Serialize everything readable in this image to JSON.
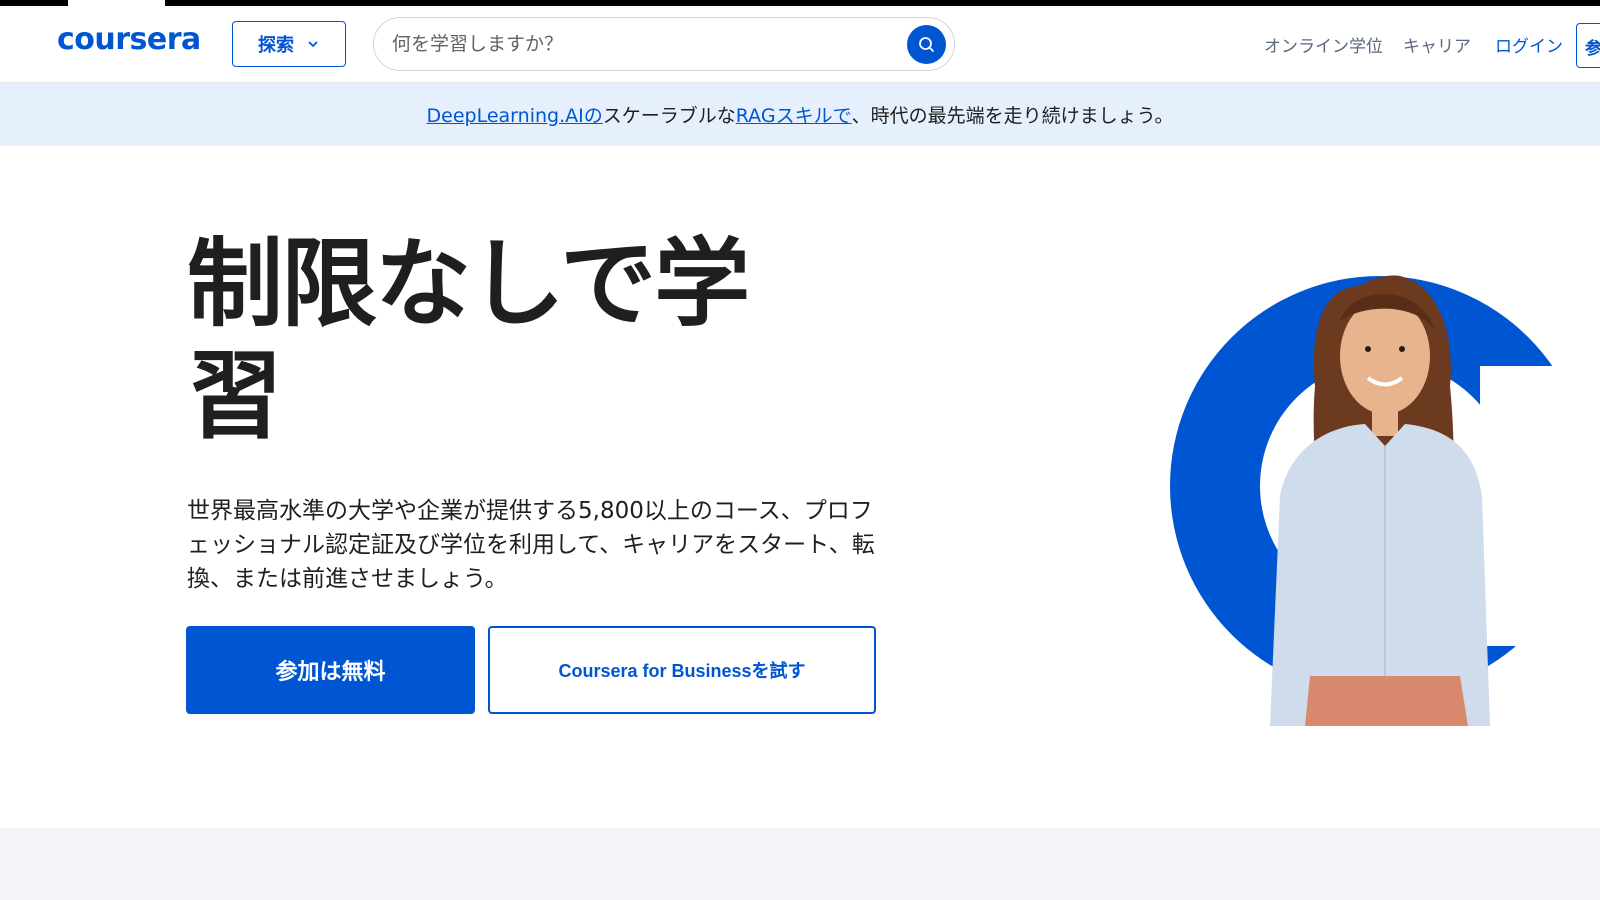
{
  "header": {
    "logo": "coursera",
    "explore_label": "探索",
    "search_placeholder": "何を学習しますか？",
    "nav": {
      "degrees": "オンライン学位",
      "careers": "キャリア",
      "login": "ログイン",
      "join": "参"
    }
  },
  "banner": {
    "link1": "DeepLearning.AIの",
    "text1": "スケーラブルな",
    "link2": "RAGスキルで",
    "text2": "、時代の最先端を走り続けましょう。"
  },
  "hero": {
    "title": "制限なしで学習",
    "description": "世界最高水準の大学や企業が提供する5,800以上のコース、プロフェッショナル認定証及び学位を利用して、キャリアをスタート、転換、または前進させましょう。",
    "primary_cta": "参加は無料",
    "secondary_cta": "Coursera for Businessを試す"
  },
  "colors": {
    "brand": "#0056d2",
    "banner_bg": "#e6f0fc"
  },
  "icons": [
    "chevron-down-icon",
    "search-icon"
  ]
}
